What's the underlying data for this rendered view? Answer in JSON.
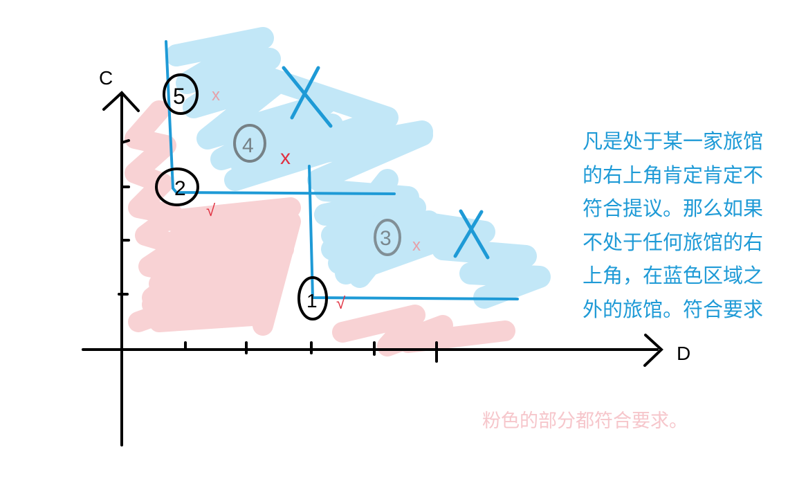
{
  "axes": {
    "x_label": "D",
    "y_label": "C"
  },
  "points": [
    {
      "id": "1",
      "label": "1",
      "mark": "√",
      "status": "符合"
    },
    {
      "id": "2",
      "label": "2",
      "mark": "√",
      "status": "符合"
    },
    {
      "id": "3",
      "label": "3",
      "mark": "x",
      "status": "不符合"
    },
    {
      "id": "4",
      "label": "4",
      "mark": "x",
      "status": "不符合"
    },
    {
      "id": "5",
      "label": "5",
      "mark": "x",
      "status": "不符合"
    }
  ],
  "blue_cross_marks": [
    "X",
    "X"
  ],
  "note": {
    "lines": [
      "凡是处于某一家旅馆",
      "的右上角肯定肯定不",
      "符合提议。那么如果",
      "不处于任何旅馆的右",
      "上角，在蓝色区域之",
      "外的旅馆。符合要求"
    ]
  },
  "pink_note": "粉色的部分都符合要求。",
  "colors": {
    "blue_line": "#1e9ad6",
    "blue_fill": "#bfe6f7",
    "pink_fill": "#f8d0d2",
    "red_mark": "#e03040",
    "note_text": "#1e9ad6",
    "pink_text": "#f6c6cb",
    "axis": "#000000"
  }
}
